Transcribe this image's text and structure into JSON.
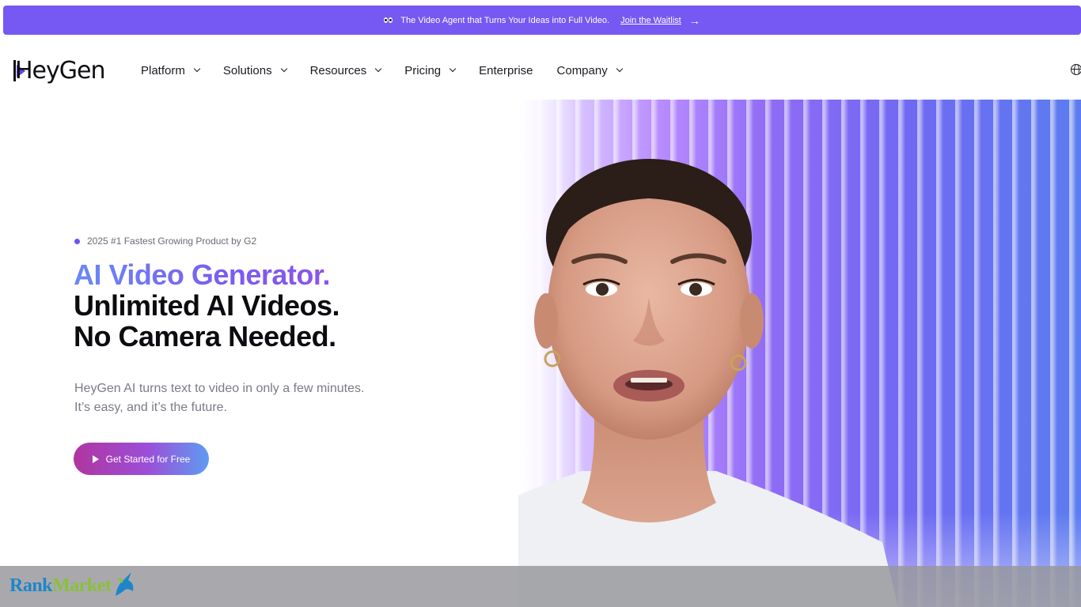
{
  "announcement": {
    "text": "The Video Agent that Turns Your Ideas into Full Video.",
    "link": "Join the Waitlist"
  },
  "nav": {
    "logo": "HeyGen",
    "items": [
      {
        "label": "Platform",
        "dropdown": true
      },
      {
        "label": "Solutions",
        "dropdown": true
      },
      {
        "label": "Resources",
        "dropdown": true
      },
      {
        "label": "Pricing",
        "dropdown": true
      },
      {
        "label": "Enterprise",
        "dropdown": false
      },
      {
        "label": "Company",
        "dropdown": true
      }
    ]
  },
  "hero": {
    "badge": "2025 #1 Fastest Growing Product by G2",
    "headline_1": "AI Video Generator.",
    "headline_2": "Unlimited AI Videos.",
    "headline_3": "No Camera Needed.",
    "subtext_1": "HeyGen AI turns text to video in only a few minutes.",
    "subtext_2": "It’s easy, and it’s the future.",
    "cta": "Get Started for Free"
  },
  "watermark": {
    "rank": "Rank",
    "market": "Market"
  },
  "colors": {
    "announce_bg": "#7559f2",
    "brand_purple": "#6a55f0",
    "text_dark": "#0c0c10",
    "text_muted": "#7b7b85"
  }
}
